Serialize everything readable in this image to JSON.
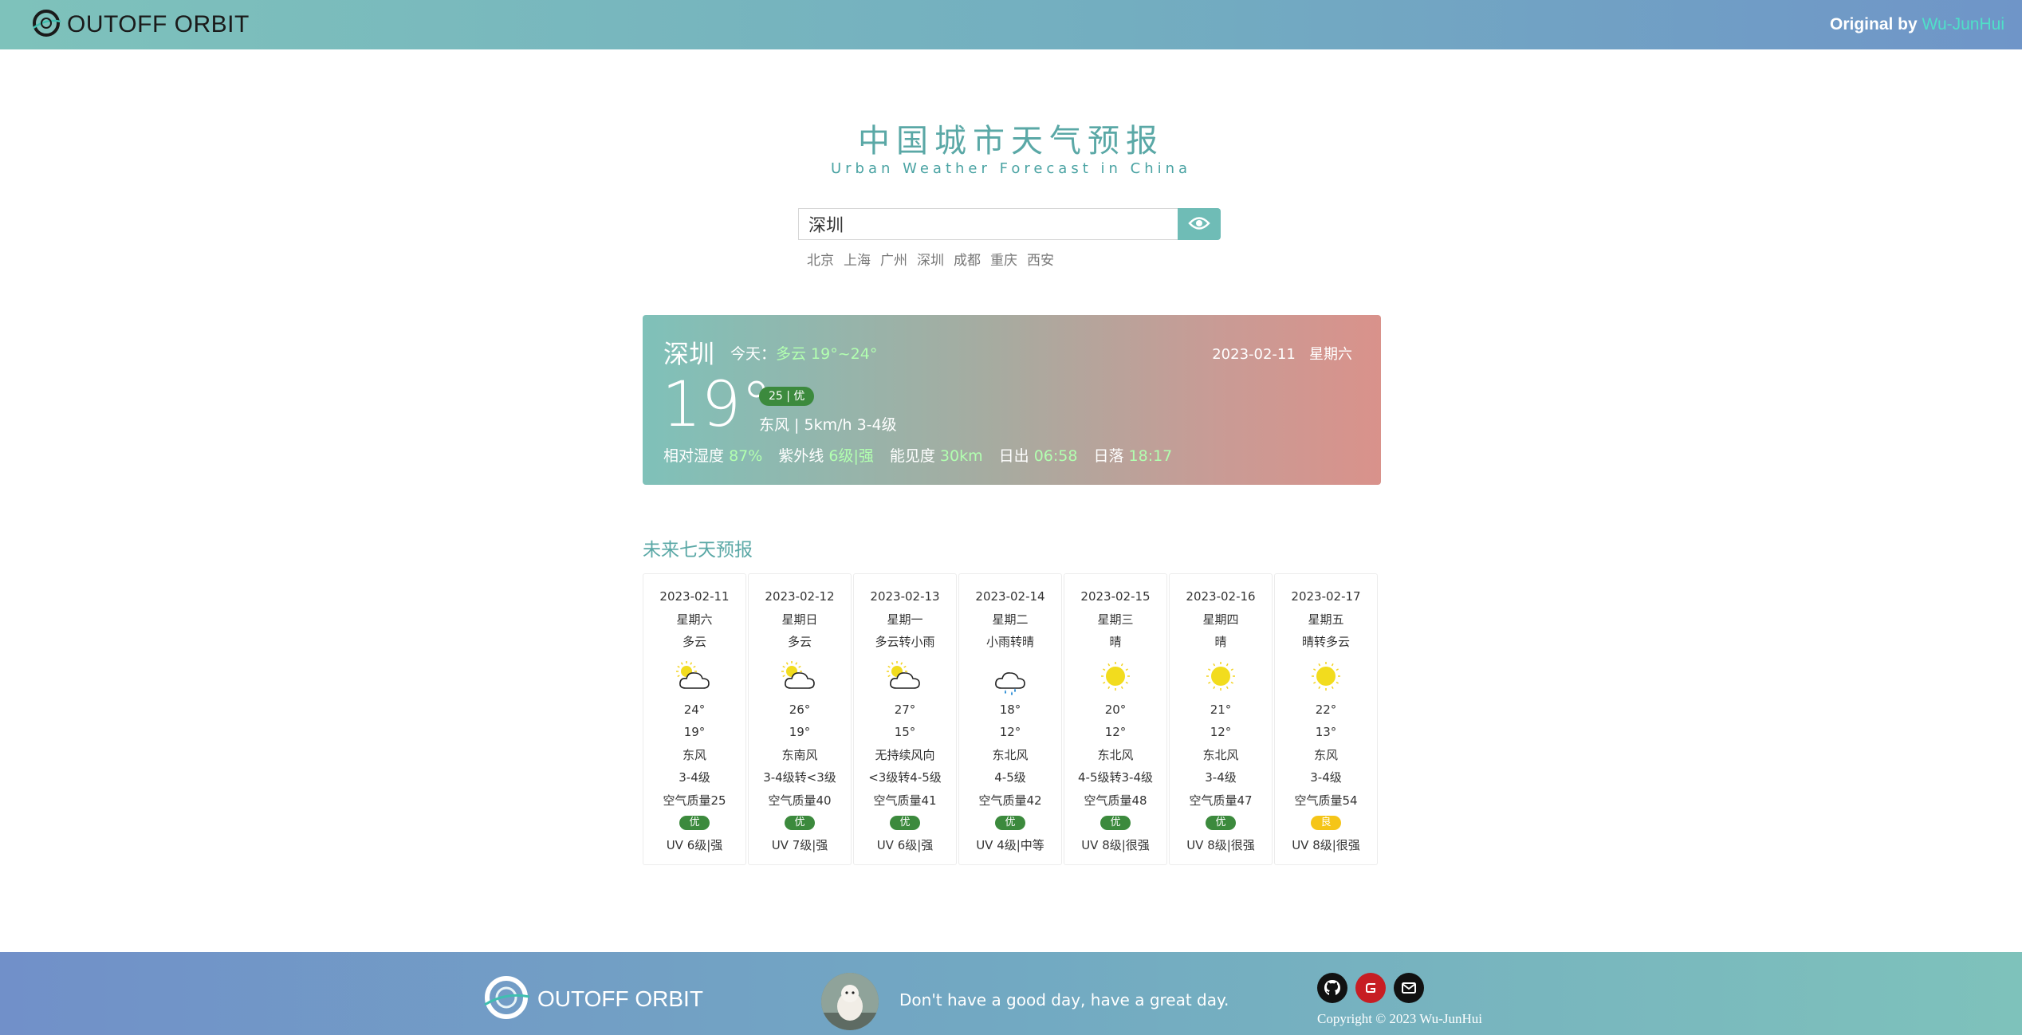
{
  "header": {
    "brand": "OUTOFF ORBIT",
    "original_by_prefix": "Original by",
    "original_by_name": "Wu-JunHui"
  },
  "title": {
    "cn": "中国城市天气预报",
    "en": "Urban Weather Forecast in China"
  },
  "search": {
    "value": "深圳",
    "button_icon": "eye-icon",
    "quick_cities": [
      "北京",
      "上海",
      "广州",
      "深圳",
      "成都",
      "重庆",
      "西安"
    ]
  },
  "current": {
    "city": "深圳",
    "today_label": "今天：",
    "today_weather": "多云 19°~24°",
    "date": "2023-02-11",
    "weekday": "星期六",
    "temp": "19°",
    "aqi": "25 | 优",
    "wind": "东风 | 5km/h 3-4级",
    "humidity_label": "相对湿度",
    "humidity": "87%",
    "uv_label": "紫外线",
    "uv": "6级|强",
    "visibility_label": "能见度",
    "visibility": "30km",
    "sunrise_label": "日出",
    "sunrise": "06:58",
    "sunset_label": "日落",
    "sunset": "18:17"
  },
  "forecast": {
    "title": "未来七天预报",
    "days": [
      {
        "date": "2023-02-11",
        "weekday": "星期六",
        "weather": "多云",
        "icon": "partly-cloudy-icon",
        "high": "24°",
        "low": "19°",
        "wind_dir": "东风",
        "wind_level": "3-4级",
        "aqi": "空气质量25",
        "aqi_level": "优",
        "aqi_color": "#3c8a3d",
        "uv": "UV 6级|强"
      },
      {
        "date": "2023-02-12",
        "weekday": "星期日",
        "weather": "多云",
        "icon": "partly-cloudy-icon",
        "high": "26°",
        "low": "19°",
        "wind_dir": "东南风",
        "wind_level": "3-4级转<3级",
        "aqi": "空气质量40",
        "aqi_level": "优",
        "aqi_color": "#3c8a3d",
        "uv": "UV 7级|强"
      },
      {
        "date": "2023-02-13",
        "weekday": "星期一",
        "weather": "多云转小雨",
        "icon": "partly-cloudy-icon",
        "high": "27°",
        "low": "15°",
        "wind_dir": "无持续风向",
        "wind_level": "<3级转4-5级",
        "aqi": "空气质量41",
        "aqi_level": "优",
        "aqi_color": "#3c8a3d",
        "uv": "UV 6级|强"
      },
      {
        "date": "2023-02-14",
        "weekday": "星期二",
        "weather": "小雨转晴",
        "icon": "light-rain-icon",
        "high": "18°",
        "low": "12°",
        "wind_dir": "东北风",
        "wind_level": "4-5级",
        "aqi": "空气质量42",
        "aqi_level": "优",
        "aqi_color": "#3c8a3d",
        "uv": "UV 4级|中等"
      },
      {
        "date": "2023-02-15",
        "weekday": "星期三",
        "weather": "晴",
        "icon": "sunny-icon",
        "high": "20°",
        "low": "12°",
        "wind_dir": "东北风",
        "wind_level": "4-5级转3-4级",
        "aqi": "空气质量48",
        "aqi_level": "优",
        "aqi_color": "#3c8a3d",
        "uv": "UV 8级|很强"
      },
      {
        "date": "2023-02-16",
        "weekday": "星期四",
        "weather": "晴",
        "icon": "sunny-icon",
        "high": "21°",
        "low": "12°",
        "wind_dir": "东北风",
        "wind_level": "3-4级",
        "aqi": "空气质量47",
        "aqi_level": "优",
        "aqi_color": "#3c8a3d",
        "uv": "UV 8级|很强"
      },
      {
        "date": "2023-02-17",
        "weekday": "星期五",
        "weather": "晴转多云",
        "icon": "sunny-icon",
        "high": "22°",
        "low": "13°",
        "wind_dir": "东风",
        "wind_level": "3-4级",
        "aqi": "空气质量54",
        "aqi_level": "良",
        "aqi_color": "#f5c518",
        "uv": "UV 8级|很强"
      }
    ]
  },
  "footer": {
    "brand": "OUTOFF ORBIT",
    "quote": "Don't have a good day, have a great day.",
    "copyright": "Copyright © 2023 Wu-JunHui",
    "socials": [
      "github-icon",
      "gitee-icon",
      "email-icon"
    ]
  }
}
